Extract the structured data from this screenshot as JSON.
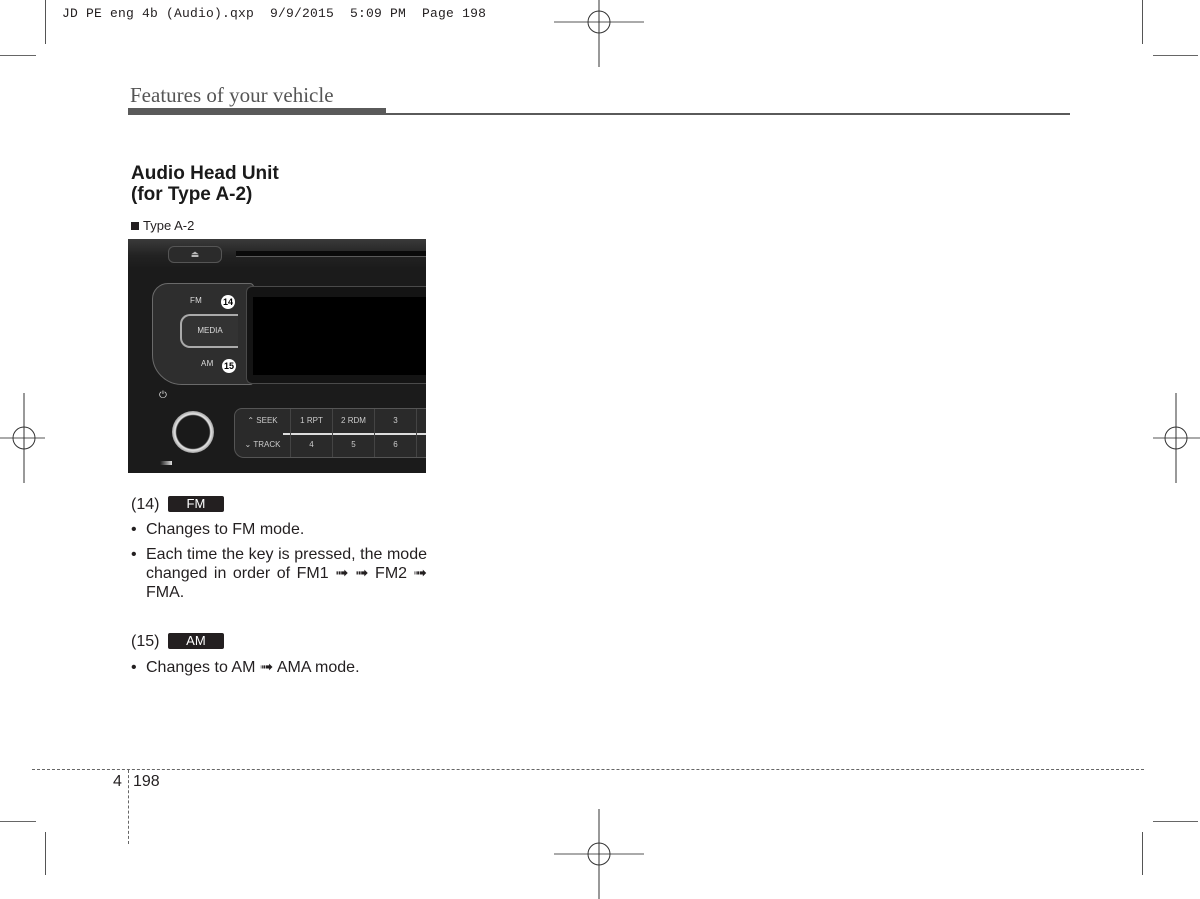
{
  "slug": "JD PE eng 4b (Audio).qxp  9/9/2015  5:09 PM  Page 198",
  "header": {
    "section_title": "Features of your vehicle"
  },
  "heading": {
    "line1": "Audio Head Unit",
    "line2": "(for Type A-2)"
  },
  "figure": {
    "caption": "Type A-2",
    "buttons": {
      "eject": "⏏",
      "fm": "FM",
      "media": "MEDIA",
      "am": "AM",
      "power": "⏻",
      "callout_fm": "14",
      "callout_am": "15"
    },
    "presets_top": [
      "⌃ SEEK",
      "1 RPT",
      "2 RDM",
      "3"
    ],
    "presets_bottom": [
      "⌄ TRACK",
      "4",
      "5",
      "6"
    ]
  },
  "items": [
    {
      "number": "(14)",
      "badge": "FM",
      "bullets": [
        "Changes to FM mode.",
        "Each time the key is pressed, the mode changed in order of FM1 ➟ ➟ FM2 ➟ FMA."
      ]
    },
    {
      "number": "(15)",
      "badge": "AM",
      "bullets": [
        "Changes to AM ➟ AMA mode."
      ]
    }
  ],
  "footer": {
    "section": "4",
    "page": "198"
  }
}
